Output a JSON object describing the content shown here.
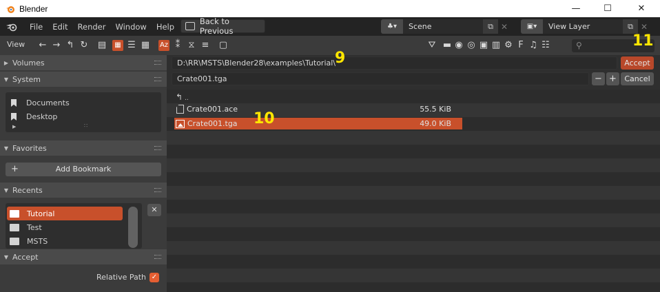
{
  "window": {
    "title": "Blender",
    "minimize_glyph": "—",
    "maximize_glyph": "☐",
    "close_glyph": "✕"
  },
  "menubar": {
    "items": [
      "File",
      "Edit",
      "Render",
      "Window",
      "Help"
    ],
    "back_button": "Back to Previous",
    "scene_name": "Scene",
    "view_layer_name": "View Layer"
  },
  "toolbar": {
    "view_label": "View",
    "icons": [
      "arrow-left-icon",
      "arrow-right-icon",
      "parent-dir-icon",
      "refresh-icon",
      "new-folder-icon",
      "thumbnails-icon",
      "short-list-icon",
      "long-list-icon",
      "sort-alpha-icon",
      "sort-ext-icon",
      "sort-time-icon",
      "sort-size-icon",
      "hidden-files-icon",
      "filter-icon",
      "filter-folder-icon",
      "filter-blend-icon",
      "filter-backup-icon",
      "filter-image-icon",
      "filter-movie-icon",
      "filter-script-icon",
      "filter-font-icon",
      "filter-sound-icon",
      "filter-text-icon",
      "search-icon"
    ]
  },
  "sidebar": {
    "volumes": {
      "label": "Volumes"
    },
    "system": {
      "label": "System",
      "items": [
        "Documents",
        "Desktop"
      ]
    },
    "favorites": {
      "label": "Favorites",
      "add_bookmark": "Add Bookmark"
    },
    "recents": {
      "label": "Recents",
      "items": [
        "Tutorial",
        "Test",
        "MSTS"
      ],
      "selected": "Tutorial",
      "remove_glyph": "✕"
    },
    "accept_panel": {
      "label": "Accept",
      "relative_path_label": "Relative Path",
      "relative_path_checked": true
    }
  },
  "main": {
    "directory_path": "D:\\RR\\MSTS\\Blender28\\examples\\Tutorial\\",
    "filename": "Crate001.tga",
    "accept_label": "Accept",
    "cancel_label": "Cancel",
    "minus_glyph": "−",
    "plus_glyph": "+",
    "parent_dir": "..",
    "files": [
      {
        "name": "Crate001.ace",
        "size": "55.5 KiB",
        "selected": false,
        "icon": "file-icon"
      },
      {
        "name": "Crate001.tga",
        "size": "49.0 KiB",
        "selected": true,
        "icon": "image-file-icon"
      }
    ]
  },
  "annotations": [
    "9",
    "10",
    "11"
  ],
  "colors": {
    "accent": "#c8502b",
    "annotation": "#ffe600",
    "panel_bg": "#3b3b3b",
    "list_bg": "#2f2f2f"
  }
}
